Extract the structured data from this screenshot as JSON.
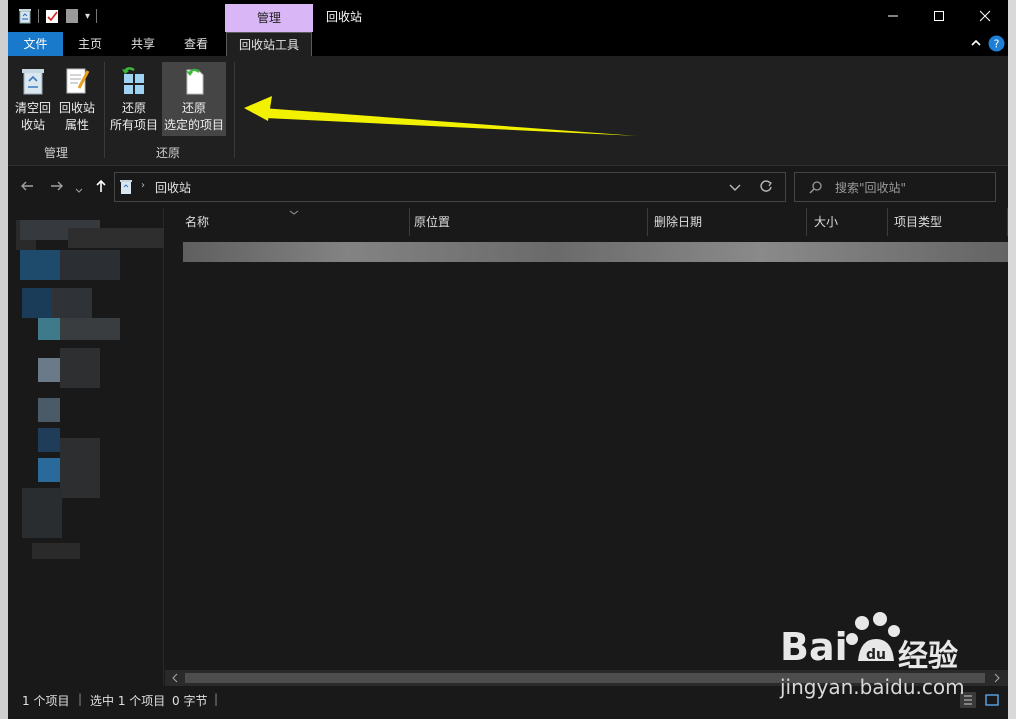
{
  "titlebar": {
    "context_tab_label": "管理",
    "window_title": "回收站"
  },
  "tabs": {
    "file": "文件",
    "home": "主页",
    "share": "共享",
    "view": "查看",
    "recycle_tools": "回收站工具"
  },
  "ribbon": {
    "empty_line1": "清空回",
    "empty_line2": "收站",
    "props_line1": "回收站",
    "props_line2": "属性",
    "restore_all_line1": "还原",
    "restore_all_line2": "所有项目",
    "restore_sel_line1": "还原",
    "restore_sel_line2": "选定的项目",
    "group_manage": "管理",
    "group_restore": "还原"
  },
  "address": {
    "path": "回收站",
    "search_placeholder": "搜索\"回收站\""
  },
  "columns": {
    "name": "名称",
    "original_location": "原位置",
    "date_deleted": "删除日期",
    "size": "大小",
    "item_type": "项目类型"
  },
  "status": {
    "count": "1 个项目",
    "selected": "选中 1 个项目",
    "bytes": "0 字节"
  },
  "watermark": {
    "brand": "Bai",
    "brand_cn": "经验",
    "url": "jingyan.baidu.com"
  },
  "colors": {
    "accent": "#1979ca",
    "context_tab": "#d9b6f5",
    "arrow": "#f2f200",
    "background": "#202020"
  }
}
